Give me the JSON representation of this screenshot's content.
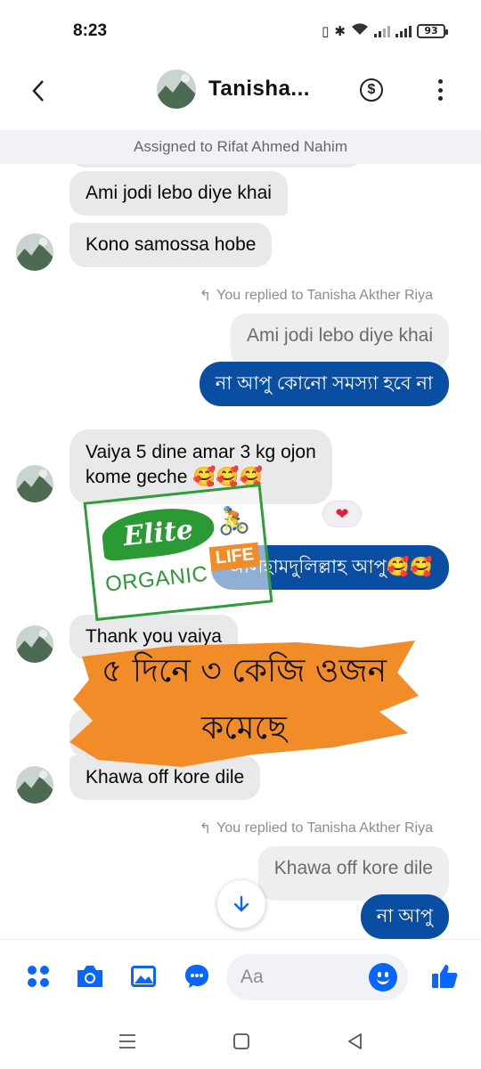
{
  "status": {
    "time": "8:23",
    "battery": "93"
  },
  "header": {
    "contact_name": "Tanisha..."
  },
  "assigned_banner": "Assigned to Rifat Ahmed Nahim",
  "messages": {
    "m1": "Ami jodi lebo diye khai",
    "m2": "Kono samossa hobe",
    "reply_label_1": "You replied to Tanisha Akther Riya",
    "reply_quote_1": "Ami jodi lebo diye khai",
    "out_1": "না আপু কোনো সমস্যা হবে না",
    "m3_line1": "Vaiya 5 dine amar 3 kg ojon",
    "m3_line2": "kome geche 🥰🥰🥰",
    "reaction_1": "❤",
    "out_2": "আলহামদুলিল্লাহ আপু🥰🥰",
    "m4": "Thank you vaiya",
    "m5": "Khawa off kore dile",
    "reply_label_2": "You replied to Tanisha Akther Riya",
    "reply_quote_2": "Khawa off kore dile",
    "out_3": "না আপু"
  },
  "overlays": {
    "logo_elite": "Elite",
    "logo_organic": "ORGANIC",
    "logo_life": "LIFE",
    "brush_line1": "৫ দিনে ৩ কেজি ওজন",
    "brush_line2": "কমেছে"
  },
  "composer": {
    "placeholder": "Aa"
  },
  "colors": {
    "accent": "#0866ff",
    "out_bubble": "#0a4ea3",
    "in_bubble": "#e9e9eb",
    "brand_green": "#2b9a34",
    "brush_orange": "#f28c28"
  },
  "icons": [
    "back-icon",
    "dollar-icon",
    "more-icon",
    "apps-icon",
    "camera-icon",
    "gallery-icon",
    "chat-icon",
    "emoji-icon",
    "like-icon",
    "scroll-down-icon",
    "reply-icon",
    "heart-icon",
    "menu-nav-icon",
    "home-nav-icon",
    "back-nav-icon"
  ]
}
